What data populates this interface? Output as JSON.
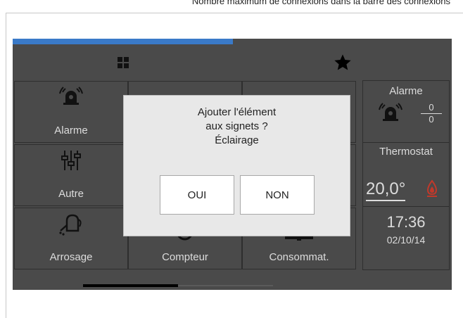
{
  "caption": "Nombre maximum de connexions dans la barre des connexions",
  "colors": {
    "accent": "#3a7ac8",
    "flame": "#c0392b"
  },
  "header": {
    "left_icon": "grid-icon",
    "right_icon": "star-icon"
  },
  "tiles": [
    {
      "label": "Alarme",
      "icon": "alarm-siren-icon"
    },
    {
      "label": "Autre",
      "icon": "sliders-icon"
    },
    {
      "label": "Arrosage",
      "icon": "watering-can-icon"
    },
    {
      "label": "Compteur",
      "icon": "meter-icon"
    },
    {
      "label": "Consommat.",
      "icon": "consumption-icon"
    }
  ],
  "side": {
    "alarm_title": "Alarme",
    "alarm_num": "0",
    "alarm_den": "0",
    "thermo_title": "Thermostat",
    "temperature": "20,0°",
    "time": "17:36",
    "date": "02/10/14"
  },
  "dialog": {
    "line1": "Ajouter l'élément",
    "line2": "aux signets ?",
    "line3": "Éclairage",
    "yes": "OUI",
    "no": "NON"
  },
  "scroll_progress": 0.5
}
